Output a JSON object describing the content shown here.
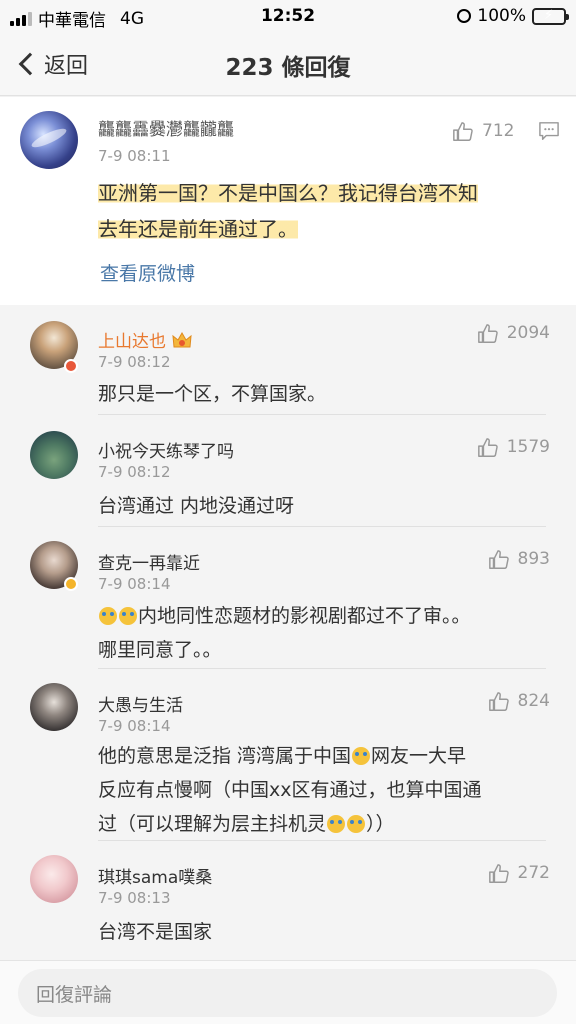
{
  "status_bar": {
    "carrier": "中華電信",
    "network": "4G",
    "time": "12:52",
    "battery": "100%"
  },
  "nav": {
    "back_label": "返回",
    "title": "223 條回復"
  },
  "main_post": {
    "username": "龘龘靐爨灪龘龖龘",
    "time": "7-9 08:11",
    "likes": "712",
    "text_line1": "亚洲第一国？不是中国么？我记得台湾不知",
    "text_line2": "去年还是前年通过了。",
    "view_original": "查看原微博"
  },
  "comments": [
    {
      "name": "上山达也",
      "time": "7-9 08:12",
      "likes": "2094",
      "lines": [
        "那只是一个区，不算国家。"
      ]
    },
    {
      "name": "小祝今天练琴了吗",
      "time": "7-9 08:12",
      "likes": "1579",
      "lines": [
        "台湾通过 内地没通过呀"
      ]
    },
    {
      "name": "查克一再靠近",
      "time": "7-9 08:14",
      "likes": "893",
      "lines": [
        "内地同性恋题材的影视剧都过不了审。。",
        "哪里同意了。。"
      ]
    },
    {
      "name": "大愚与生活",
      "time": "7-9 08:14",
      "likes": "824",
      "lines": [
        "他的意思是泛指 湾湾属于中国",
        "网友一大早",
        "反应有点慢啊（中国xx区有通过，也算中国通",
        "过（可以理解为层主抖机灵",
        "））"
      ]
    },
    {
      "name": "琪琪sama噗桑",
      "time": "7-9 08:13",
      "likes": "272",
      "lines": [
        "台湾不是国家"
      ]
    }
  ],
  "input": {
    "placeholder": "回復評論"
  },
  "colors": {
    "vip_name": "#e8782e",
    "link": "#4a78a8",
    "highlight": "#fce28c"
  }
}
